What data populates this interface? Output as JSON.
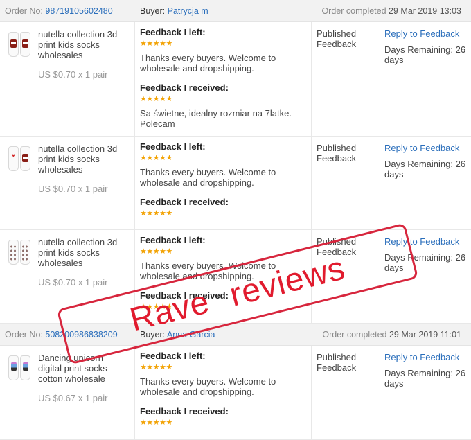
{
  "colors": {
    "link": "#2a6ebb",
    "star": "#f2a203",
    "stamp": "#e11b2e",
    "header_bg": "#f2f2f2"
  },
  "labels": {
    "order_no": "Order No:",
    "buyer": "Buyer:",
    "order_completed": "Order completed",
    "feedback_left": "Feedback I left:",
    "feedback_received": "Feedback I received:",
    "status": "Published Feedback",
    "reply": "Reply to Feedback",
    "days_remaining": "Days Remaining: 26 days",
    "stars": "★★★★★"
  },
  "orders": [
    {
      "order_no": "98719105602480",
      "buyer": "Patrycja m",
      "completed": "29 Mar 2019 13:03",
      "items": [
        {
          "name": "nutella collection 3d print kids socks wholesales",
          "price": "US $0.70 x 1 pair",
          "icon": "nutella-socks-icon",
          "left_text": "Thanks every buyers. Welcome to wholesale and dropshipping.",
          "received_text": "Sa świetne, idealny rozmiar na 7latke. Polecam"
        },
        {
          "name": "nutella collection 3d print kids socks wholesales",
          "price": "US $0.70 x 1 pair",
          "icon": "heart-nutella-socks-icon",
          "left_text": "Thanks every buyers. Welcome to wholesale and dropshipping.",
          "received_text": ""
        },
        {
          "name": "nutella collection 3d print kids socks wholesales",
          "price": "US $0.70 x 1 pair",
          "icon": "patterned-socks-icon",
          "left_text": "Thanks every buyers. Welcome to wholesale and dropshipping.",
          "received_text": ""
        }
      ]
    },
    {
      "order_no": "508200986838209",
      "buyer": "Anna Garcia",
      "completed": "29 Mar 2019 11:01",
      "items": [
        {
          "name": "Dancing unicorn digital print socks cotton wholesale",
          "price": "US $0.67 x 1 pair",
          "icon": "unicorn-socks-icon",
          "left_text": "Thanks every buyers. Welcome to wholesale and dropshipping.",
          "received_text": ""
        }
      ]
    }
  ],
  "stamp": {
    "text": "Rave reviews"
  }
}
